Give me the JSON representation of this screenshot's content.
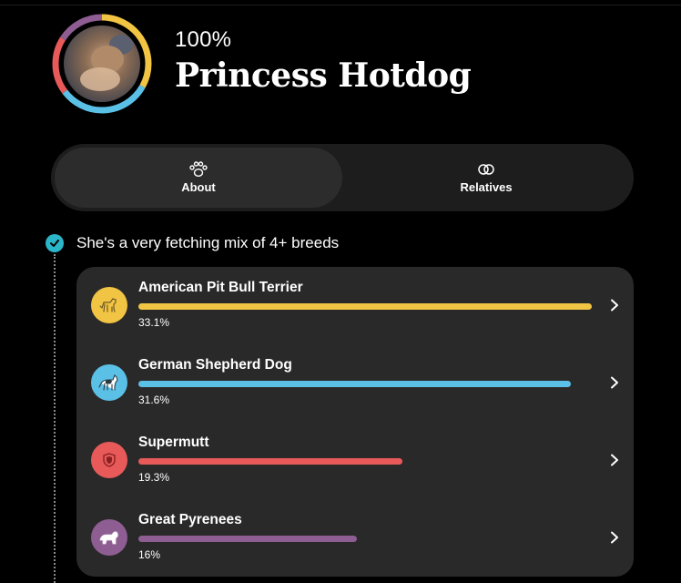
{
  "header": {
    "percent": "100%",
    "dog_name": "Princess Hotdog",
    "ring_colors": [
      "#f2c443",
      "#5bc0e6",
      "#e85a5a",
      "#8e5d92"
    ]
  },
  "tabs": [
    {
      "label": "About",
      "icon": "paw-icon",
      "active": true
    },
    {
      "label": "Relatives",
      "icon": "rings-icon",
      "active": false
    }
  ],
  "section": {
    "heading": "She's a very fetching mix of 4+ breeds",
    "check_color": "#2bb5c9"
  },
  "breeds": [
    {
      "name": "American Pit Bull Terrier",
      "percent_label": "33.1%",
      "fraction": 0.331,
      "color": "#f2c443",
      "icon": "pit-bull-icon"
    },
    {
      "name": "German Shepherd Dog",
      "percent_label": "31.6%",
      "fraction": 0.316,
      "color": "#5bc0e6",
      "icon": "german-shepherd-icon"
    },
    {
      "name": "Supermutt",
      "percent_label": "19.3%",
      "fraction": 0.193,
      "color": "#e85a5a",
      "icon": "supermutt-shield-icon"
    },
    {
      "name": "Great Pyrenees",
      "percent_label": "16%",
      "fraction": 0.16,
      "color": "#8e5d92",
      "icon": "great-pyrenees-icon"
    }
  ]
}
